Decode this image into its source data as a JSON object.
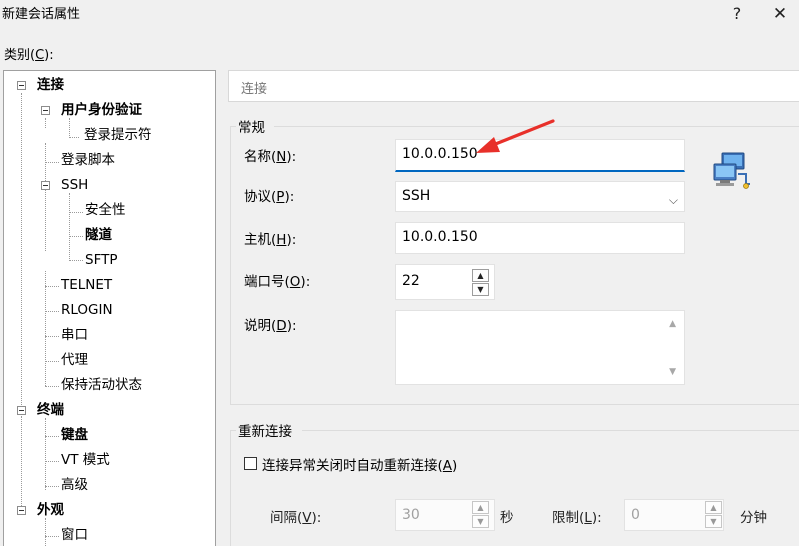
{
  "window": {
    "title": "新建会话属性",
    "help_glyph": "?",
    "close_glyph": "✕"
  },
  "category": {
    "label": "类别(",
    "hotkey": "C",
    "suffix": "):"
  },
  "tree": {
    "items": [
      {
        "label": "连接",
        "bold": true
      },
      {
        "label": "用户身份验证",
        "bold": true
      },
      {
        "label": "登录提示符",
        "bold": false
      },
      {
        "label": "登录脚本",
        "bold": false
      },
      {
        "label": "SSH",
        "bold": false
      },
      {
        "label": "安全性",
        "bold": false
      },
      {
        "label": "隧道",
        "bold": true
      },
      {
        "label": "SFTP",
        "bold": false
      },
      {
        "label": "TELNET",
        "bold": false
      },
      {
        "label": "RLOGIN",
        "bold": false
      },
      {
        "label": "串口",
        "bold": false
      },
      {
        "label": "代理",
        "bold": false
      },
      {
        "label": "保持活动状态",
        "bold": false
      },
      {
        "label": "终端",
        "bold": true
      },
      {
        "label": "键盘",
        "bold": true
      },
      {
        "label": "VT 模式",
        "bold": false
      },
      {
        "label": "高级",
        "bold": false
      },
      {
        "label": "外观",
        "bold": true
      },
      {
        "label": "窗口",
        "bold": false
      }
    ]
  },
  "panel": {
    "header": "连接",
    "general_group": "常规",
    "name": {
      "label": "名称(",
      "hotkey": "N",
      "suffix": "):",
      "value": "10.0.0.150"
    },
    "protocol": {
      "label": "协议(",
      "hotkey": "P",
      "suffix": "):",
      "value": "SSH"
    },
    "host": {
      "label": "主机(",
      "hotkey": "H",
      "suffix": "):",
      "value": "10.0.0.150"
    },
    "port": {
      "label": "端口号(",
      "hotkey": "O",
      "suffix": "):",
      "value": "22"
    },
    "description": {
      "label": "说明(",
      "hotkey": "D",
      "suffix": "):",
      "value": ""
    },
    "reconnect_group": "重新连接",
    "reconnect_checkbox": {
      "label": "连接异常关闭时自动重新连接(",
      "hotkey": "A",
      "suffix": ")",
      "checked": false
    },
    "interval": {
      "label": "间隔(",
      "hotkey": "V",
      "suffix": "):",
      "value": "30",
      "unit": "秒"
    },
    "limit": {
      "label": "限制(",
      "hotkey": "L",
      "suffix": "):",
      "value": "0",
      "unit": "分钟"
    }
  },
  "colors": {
    "annotation_arrow": "#e8302a",
    "focus_underline": "#0067c0"
  },
  "icons": {
    "network": "network-computers-icon",
    "spin_up": "▲",
    "spin_down": "▼",
    "scroll_up": "▲",
    "scroll_down": "▼",
    "select_arrow": "⌵"
  }
}
